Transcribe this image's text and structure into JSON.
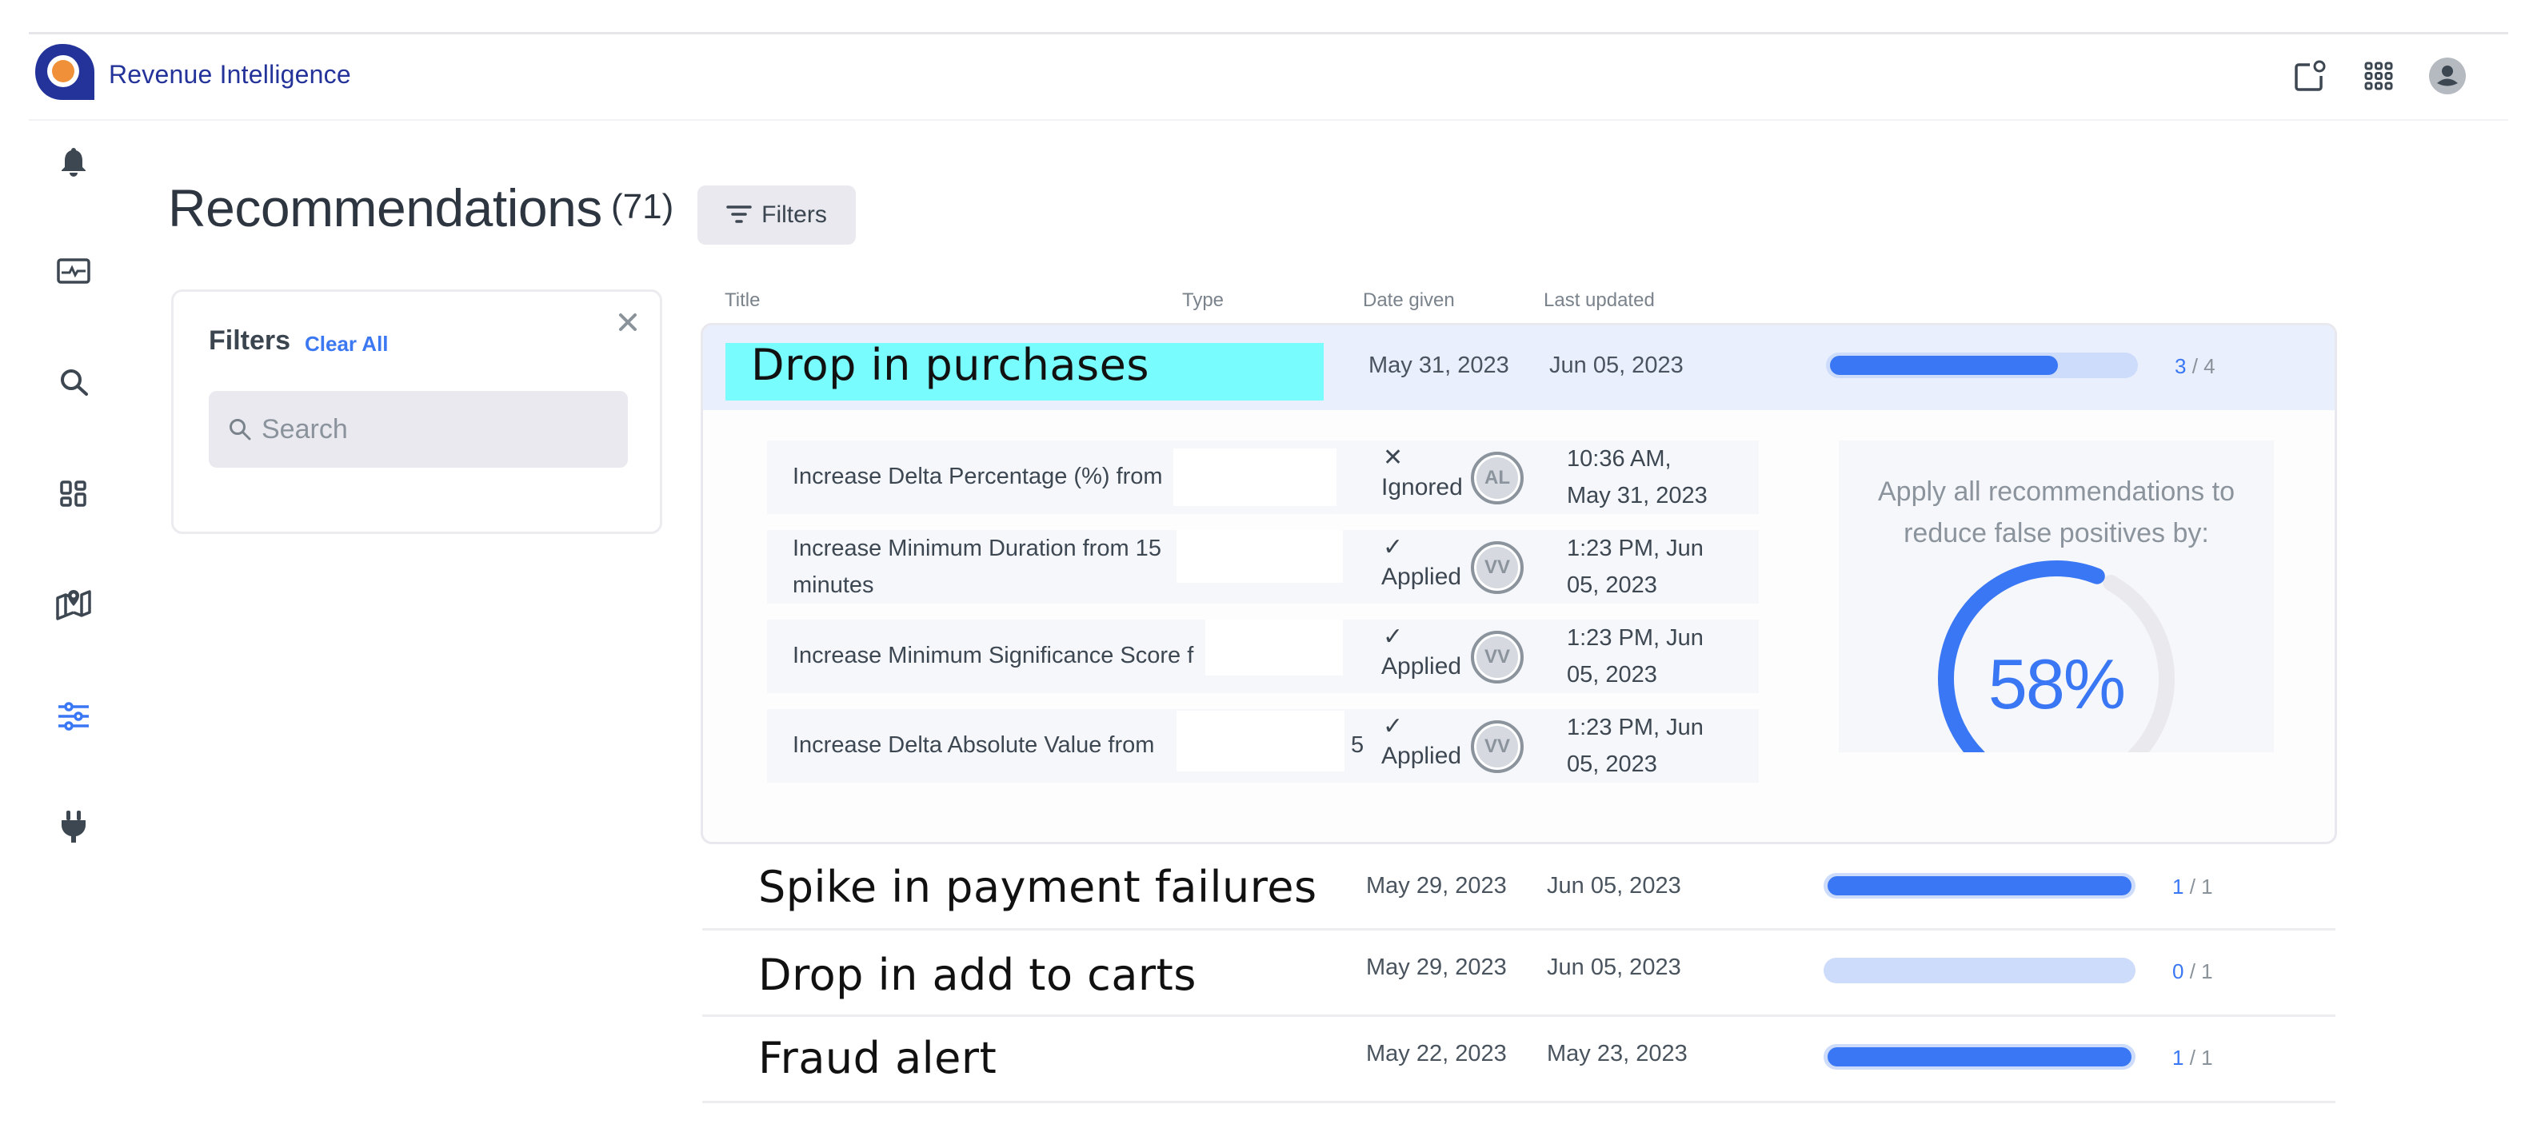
{
  "app": {
    "title": "Revenue Intelligence",
    "brand_color": "#23339a",
    "logo_accent": "#f0913a"
  },
  "header_icons": [
    {
      "name": "notifications-panel-icon"
    },
    {
      "name": "apps-grid-icon"
    },
    {
      "name": "user-avatar-icon"
    }
  ],
  "sidebar": {
    "items": [
      {
        "name": "alerts",
        "icon": "bell-icon",
        "active": false
      },
      {
        "name": "monitoring",
        "icon": "pulse-monitor-icon",
        "active": false
      },
      {
        "name": "search",
        "icon": "search-icon",
        "active": false
      },
      {
        "name": "dashboards",
        "icon": "dashboard-icon",
        "active": false
      },
      {
        "name": "explore",
        "icon": "map-pin-icon",
        "active": false
      },
      {
        "name": "recommendations",
        "icon": "sliders-icon",
        "active": true
      },
      {
        "name": "integrations",
        "icon": "plug-icon",
        "active": false
      }
    ]
  },
  "page": {
    "title": "Recommendations",
    "count": "(71)",
    "filters_button": "Filters"
  },
  "filter_panel": {
    "title": "Filters",
    "clear_all": "Clear All",
    "search_placeholder": "Search",
    "search_value": ""
  },
  "table": {
    "columns": [
      "Title",
      "Type",
      "Date given",
      "Last updated"
    ],
    "rows": [
      {
        "title": "Drop in purchases",
        "type": "",
        "date_given": "May 31, 2023",
        "last_updated": "Jun 05, 2023",
        "progress": {
          "done": "3",
          "total": "4",
          "fraction": 0.75
        },
        "expanded": true,
        "recommendations": [
          {
            "text": "Increase Delta Percentage (%) from",
            "status_icon": "✕",
            "status": "Ignored",
            "user": "AL",
            "time_line1": "10:36 AM,",
            "time_line2": "May 31, 2023"
          },
          {
            "text": "Increase Minimum Duration from 15",
            "text_line2": "minutes",
            "status_icon": "✓",
            "status": "Applied",
            "user": "VV",
            "time_line1": "1:23 PM, Jun",
            "time_line2": "05, 2023"
          },
          {
            "text": "Increase Minimum Significance Score f",
            "status_icon": "✓",
            "status": "Applied",
            "user": "VV",
            "time_line1": "1:23 PM, Jun",
            "time_line2": "05, 2023"
          },
          {
            "text": "Increase Delta Absolute Value from",
            "text_tail": "5",
            "status_icon": "✓",
            "status": "Applied",
            "user": "VV",
            "time_line1": "1:23 PM, Jun",
            "time_line2": "05, 2023"
          }
        ],
        "impact": {
          "label_line1": "Apply all recommendations to",
          "label_line2": "reduce false positives by:",
          "value_text": "58%",
          "value_fraction": 0.58
        }
      },
      {
        "title": "Spike in payment failures",
        "type": "",
        "date_given": "May 29, 2023",
        "last_updated": "Jun 05, 2023",
        "progress": {
          "done": "1",
          "total": "1",
          "fraction": 1.0
        }
      },
      {
        "title": "Drop in add to carts",
        "type": "",
        "date_given": "May 29, 2023",
        "last_updated": "Jun 05, 2023",
        "progress": {
          "done": "0",
          "total": "1",
          "fraction": 0.0
        }
      },
      {
        "title": "Fraud alert",
        "type": "",
        "date_given": "May 22, 2023",
        "last_updated": "May 23, 2023",
        "progress": {
          "done": "1",
          "total": "1",
          "fraction": 1.0
        }
      }
    ]
  },
  "colors": {
    "accent": "#3a77f4",
    "progress_track": "#cddcfa",
    "expanded_header_bg": "#e9effd",
    "highlight": "#78fcfd"
  }
}
